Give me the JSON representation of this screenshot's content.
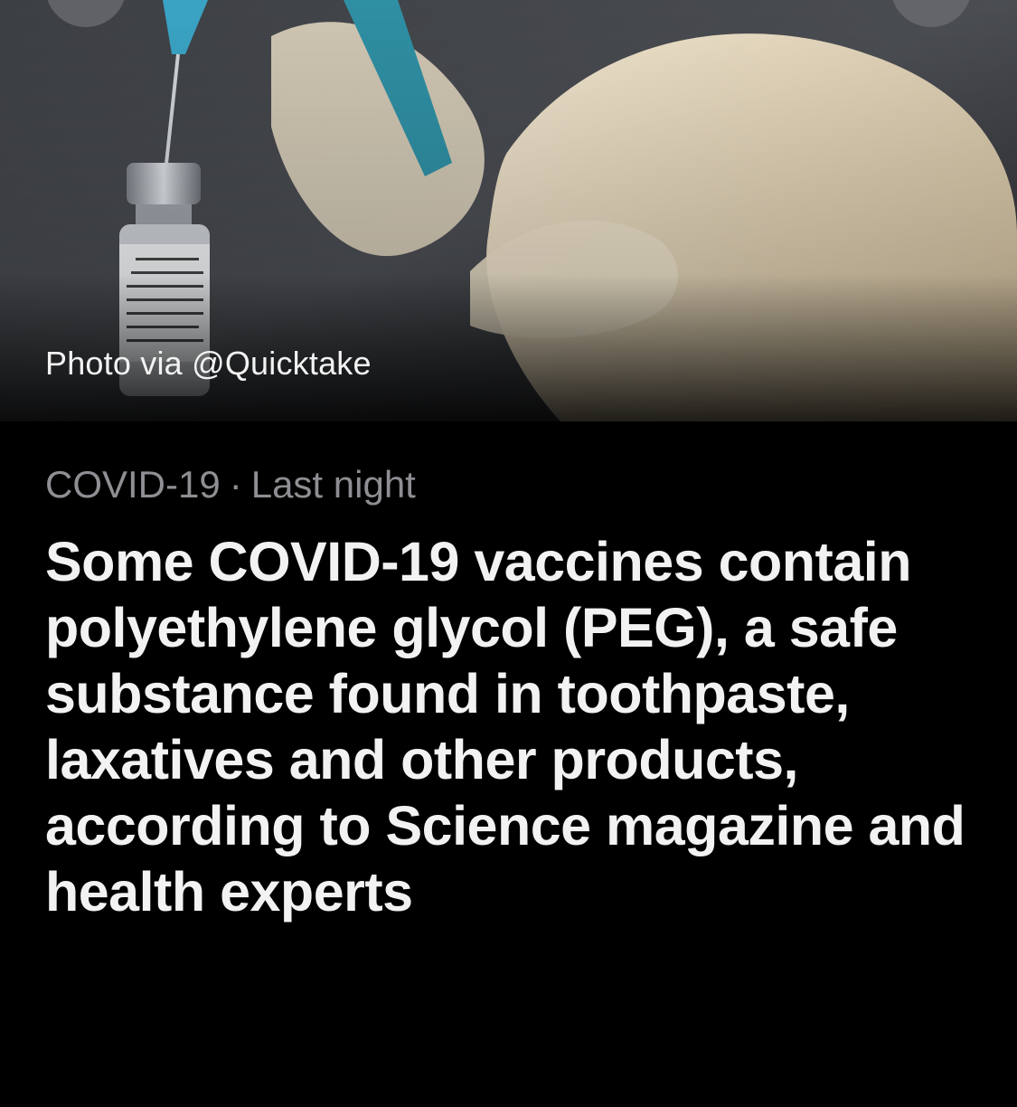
{
  "hero": {
    "caption": "Photo via @Quicktake"
  },
  "article": {
    "topic": "COVID-19",
    "separator": "·",
    "time": "Last night",
    "headline": "Some COVID-19 vaccines contain polyethylene glycol (PEG), a safe substance found in toothpaste, laxatives and other products, according to Science magazine and health experts"
  },
  "colors": {
    "background": "#000000",
    "headline": "#f2f2f2",
    "meta": "#8e8e93"
  },
  "icons": {
    "left_button": "back-icon",
    "right_button": "more-icon"
  }
}
